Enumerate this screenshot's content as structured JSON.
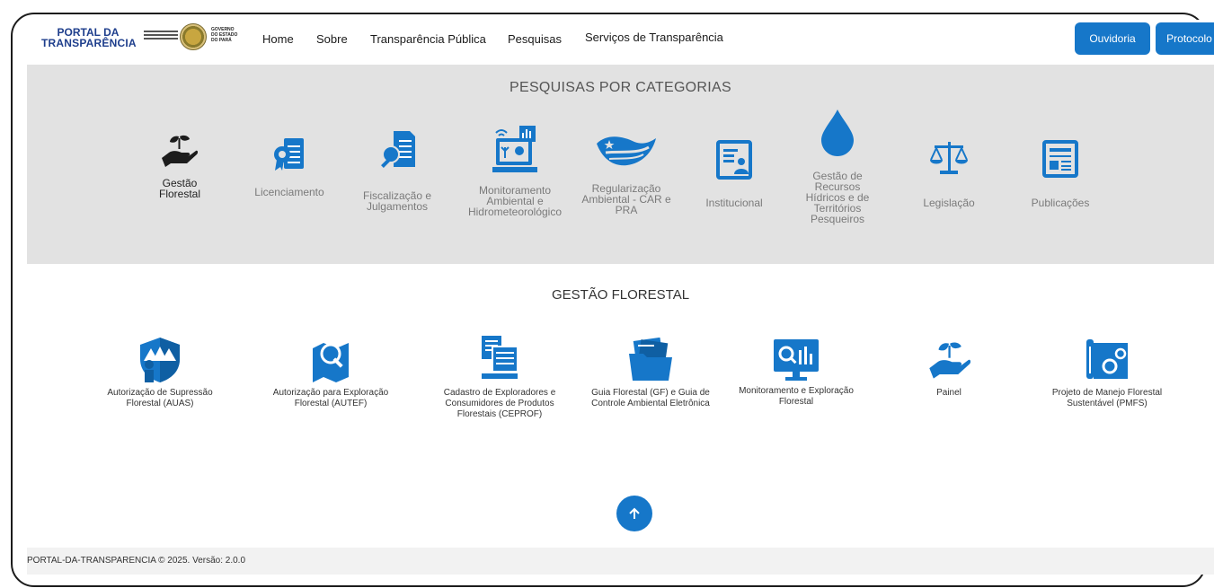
{
  "header": {
    "logo_line1": "PORTAL DA",
    "logo_line2": "TRANSPARÊNCIA",
    "gov_text": "GOVERNO DO ESTADO DO PARÁ",
    "nav": [
      "Home",
      "Sobre",
      "Transparência Pública",
      "Pesquisas",
      "Serviços de Transparência"
    ],
    "buttons": {
      "ouvidoria": "Ouvidoria",
      "protocolo": "Protocolo"
    }
  },
  "categories": {
    "title": "PESQUISAS POR CATEGORIAS",
    "items": [
      {
        "label": "Gestão Florestal",
        "icon": "hand-plant-icon"
      },
      {
        "label": "Licenciamento",
        "icon": "license-document-icon"
      },
      {
        "label": "Fiscalização e Julgamentos",
        "icon": "inspection-search-icon"
      },
      {
        "label": "Monitoramento Ambiental e Hidrometeorológico",
        "icon": "environmental-monitor-icon"
      },
      {
        "label": "Regularização Ambiental - CAR e PRA",
        "icon": "pará-flag-icon"
      },
      {
        "label": "Institucional",
        "icon": "institutional-profile-icon"
      },
      {
        "label": "Gestão de Recursos Hídricos e de Territórios Pesqueiros",
        "icon": "water-drop-icon"
      },
      {
        "label": "Legislação",
        "icon": "scales-icon"
      },
      {
        "label": "Publicações",
        "icon": "publication-icon"
      }
    ]
  },
  "gestao_florestal": {
    "title": "GESTÃO FLORESTAL",
    "services": [
      {
        "label": "Autorização de Supressão Florestal (AUAS)",
        "icon": "forest-shield-icon"
      },
      {
        "label": "Autorização para Exploração Florestal (AUTEF)",
        "icon": "map-search-icon"
      },
      {
        "label": "Cadastro de Exploradores e Consumidores de Produtos Florestais (CEPROF)",
        "icon": "register-computer-icon"
      },
      {
        "label": "Guia Florestal (GF) e Guia de Controle Ambiental Eletrônica",
        "icon": "folder-documents-icon"
      },
      {
        "label": "Monitoramento e Exploração Florestal",
        "icon": "monitor-chart-icon"
      },
      {
        "label": "Painel",
        "icon": "hand-plant-icon"
      },
      {
        "label": "Projeto de Manejo Florestal Sustentável (PMFS)",
        "icon": "blueprint-gear-icon"
      }
    ]
  },
  "footer": {
    "text": "PORTAL-DA-TRANSPARENCIA © 2025. Versão: 2.0.0"
  },
  "colors": {
    "brand_blue": "#1677c9",
    "dark_blue": "#1e3e8c",
    "category_bg": "#e2e2e2"
  }
}
